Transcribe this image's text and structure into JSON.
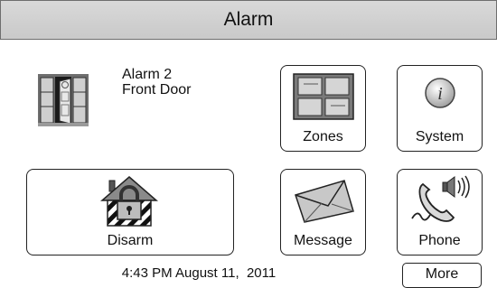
{
  "header": {
    "title": "Alarm"
  },
  "alarm": {
    "line1": "Alarm 2",
    "line2": "Front Door",
    "icon": "open-door-icon"
  },
  "tiles": {
    "zones": {
      "label": "Zones",
      "icon": "zones-grid-icon"
    },
    "system": {
      "label": "System",
      "icon": "info-icon"
    },
    "disarm": {
      "label": "Disarm",
      "icon": "house-padlock-icon"
    },
    "message": {
      "label": "Message",
      "icon": "envelope-icon"
    },
    "phone": {
      "label": "Phone",
      "icon": "phone-speaker-icon"
    }
  },
  "status": {
    "time": "4:43 PM",
    "date": "August 11,  2011"
  },
  "more": {
    "label": "More"
  },
  "colors": {
    "header_bg": "#d0d0d0",
    "border": "#222222"
  }
}
